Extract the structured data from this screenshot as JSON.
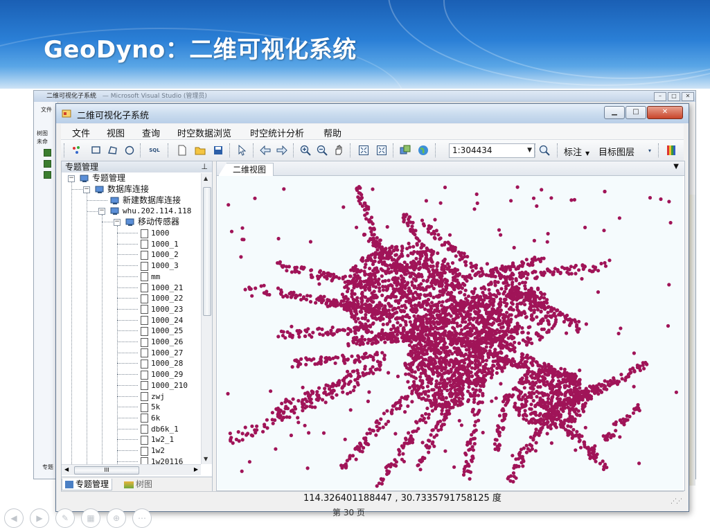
{
  "slide": {
    "title": "GeoDyno：二维可视化系统",
    "page_number": "第 30 页"
  },
  "bg_window": {
    "title": "二维可视化子系统",
    "title_extra": "— Microsoft Visual Studio (管理员)",
    "menu_label": "文件",
    "side_labels": [
      "树图",
      "未命"
    ],
    "bottom_label": "专题"
  },
  "window": {
    "title": "二维可视化子系统",
    "controls": {
      "minimize": "▁",
      "maximize": "□",
      "close": "✕"
    },
    "menu": [
      "文件",
      "视图",
      "查询",
      "时空数据浏览",
      "时空统计分析",
      "帮助"
    ],
    "toolbar": {
      "scale_value": "1:304434",
      "label_button": "标注",
      "target_layer_button": "目标图层",
      "sql_label": "SQL"
    },
    "left_panel": {
      "title": "专题管理",
      "tree": {
        "root": "专题管理",
        "db_connections": "数据库连接",
        "new_connection": "新建数据库连接",
        "server": "whu.202.114.118",
        "sensor_group": "移动传感器",
        "layers": [
          "1000",
          "1000_1",
          "1000_2",
          "1000_3",
          "mm",
          "1000_21",
          "1000_22",
          "1000_23",
          "1000_24",
          "1000_25",
          "1000_26",
          "1000_27",
          "1000_28",
          "1000_29",
          "1000_210",
          "zwj",
          "5k",
          "6k",
          "db6k_1",
          "1w2_1",
          "1w2",
          "1w20116"
        ]
      },
      "tabs": [
        "专题管理",
        "树图"
      ]
    },
    "map": {
      "tab_label": "二维视图",
      "point_color": "#a01458",
      "background_color": "#f5fbfd"
    },
    "status": {
      "coordinates": "114.326401188447 , 30.7335791758125 度"
    }
  },
  "icons": [
    "app-icon",
    "select-icon",
    "zoom-in-icon",
    "zoom-out-icon",
    "pan-icon",
    "globe-icon",
    "search-icon",
    "color-bar-icon"
  ]
}
